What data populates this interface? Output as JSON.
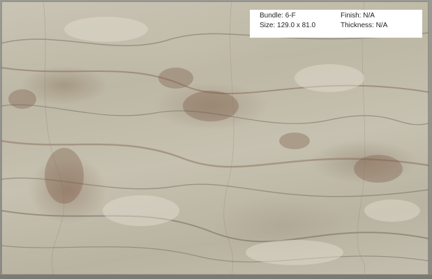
{
  "label": {
    "bundle": "Bundle: 6-F",
    "finish": "Finish: N/A",
    "size": "Size: 129.0 x 81.0",
    "thickness": "Thickness: N/A"
  },
  "colors": {
    "stone_base": "#c3beae",
    "vein_brown": "#7a5a45",
    "vein_gray": "#6e6a60",
    "label_background": "#ffffff"
  }
}
